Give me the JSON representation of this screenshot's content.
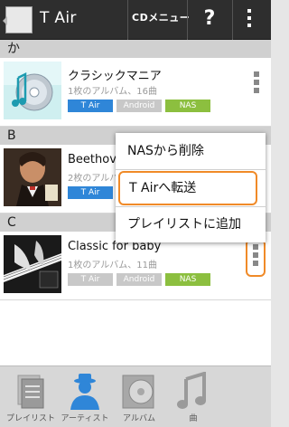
{
  "app": {
    "title": "T Air"
  },
  "header": {
    "cd_menu_label": "CDメニュー",
    "help_label": "?"
  },
  "sections": [
    {
      "letter": "か"
    },
    {
      "letter": "B"
    },
    {
      "letter": "C"
    }
  ],
  "items": [
    {
      "title": "クラシックマニア",
      "subtitle": "1枚のアルバム、16曲",
      "badges": {
        "tair": "T Air",
        "android": "Android",
        "nas": "NAS"
      }
    },
    {
      "title": "Beethoven",
      "subtitle": "2枚のアルバム、",
      "badges": {
        "tair": "T Air"
      }
    },
    {
      "title": "Classic for baby",
      "subtitle": "1枚のアルバム、11曲",
      "badges": {
        "tair": "T Air",
        "android": "Android",
        "nas": "NAS"
      }
    }
  ],
  "popup_menu": {
    "items": [
      {
        "label": "NASから削除"
      },
      {
        "label": "T Airへ転送"
      },
      {
        "label": "プレイリストに追加"
      }
    ]
  },
  "tabs": [
    {
      "label": "プレイリスト",
      "icon": "playlist-icon"
    },
    {
      "label": "アーティスト",
      "icon": "artist-icon"
    },
    {
      "label": "アルバム",
      "icon": "album-icon"
    },
    {
      "label": "曲",
      "icon": "music-note-icon"
    }
  ],
  "colors": {
    "titlebar": "#2e2e2e",
    "badge_tair": "#2f86d8",
    "badge_android": "#c8c8c8",
    "badge_nas": "#8cbf3f",
    "highlight": "#f08a28",
    "artist_tab_active": "#2f86d8"
  }
}
